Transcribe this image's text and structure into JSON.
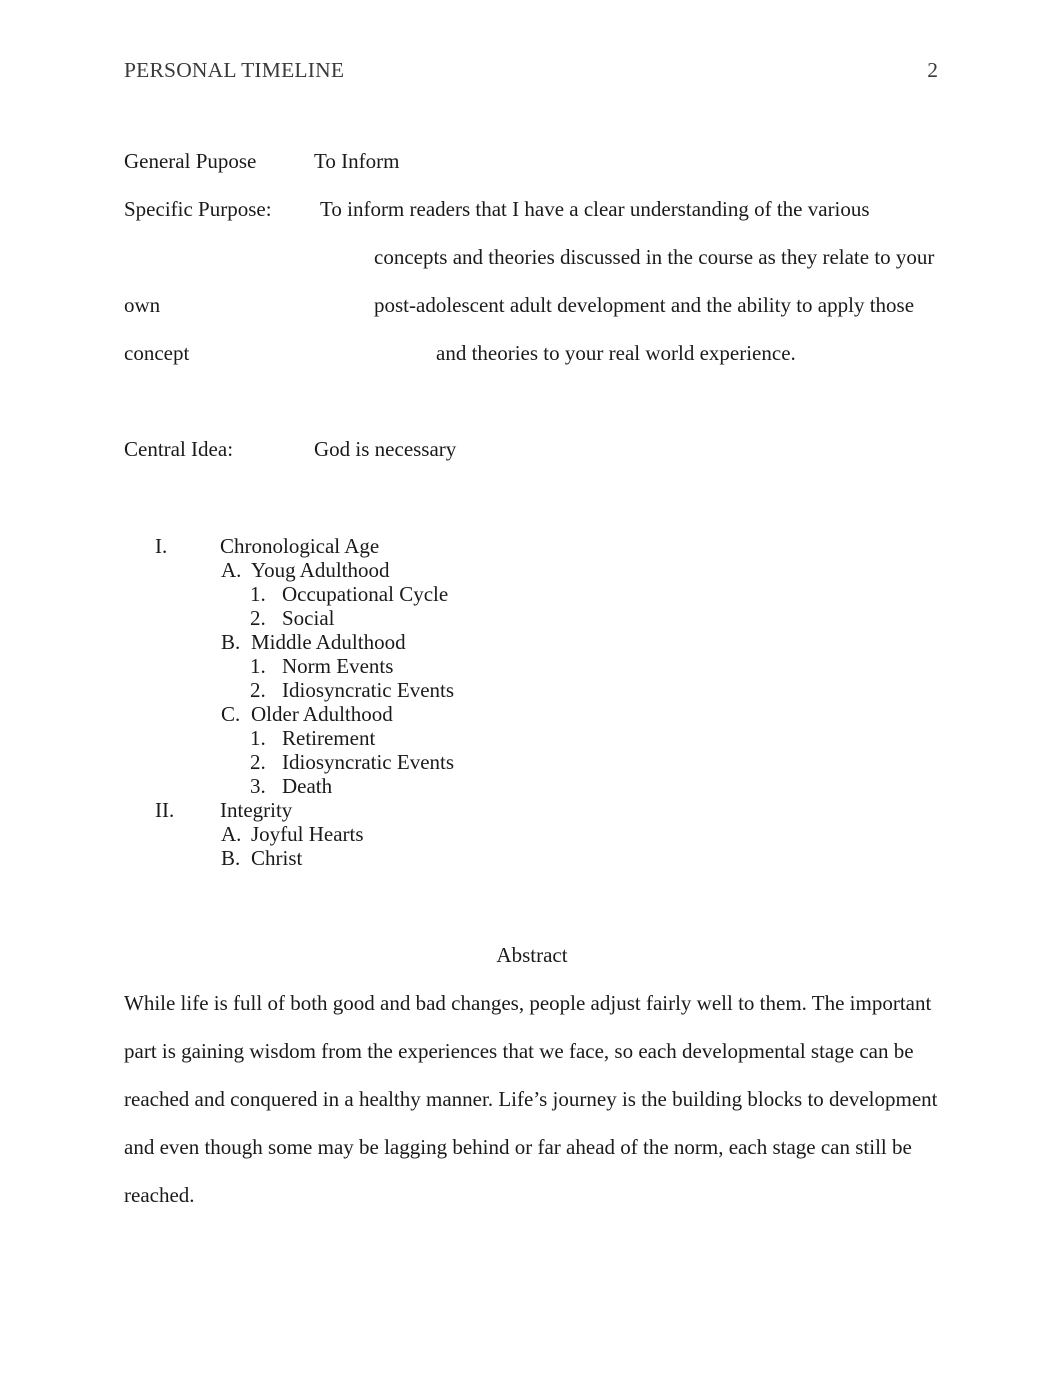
{
  "document": {
    "running_head": "PERSONAL TIMELINE",
    "page_number": "2"
  },
  "purpose": {
    "general_label": "General Pupose",
    "general_value": "To Inform",
    "specific_label": "Specific Purpose:",
    "specific_line1": "To inform readers that I have a clear understanding of the various",
    "specific_line2": "concepts and theories discussed in the course as they relate to your",
    "specific_line3_label": "own",
    "specific_line3": "post-adolescent adult development and the ability to apply those",
    "specific_line4_label": "concept",
    "specific_line4": "and theories to your real world experience.",
    "central_label": "Central Idea:",
    "central_value": "God is necessary"
  },
  "outline": [
    {
      "level": 1,
      "marker": "I.",
      "text": "Chronological Age"
    },
    {
      "level": 2,
      "marker": "A.",
      "text": "Youg Adulthood"
    },
    {
      "level": 3,
      "marker": "1.",
      "text": "Occupational Cycle"
    },
    {
      "level": 3,
      "marker": "2.",
      "text": "Social"
    },
    {
      "level": 2,
      "marker": "B.",
      "text": "Middle Adulthood"
    },
    {
      "level": 3,
      "marker": "1.",
      "text": "Norm Events"
    },
    {
      "level": 3,
      "marker": "2.",
      "text": "Idiosyncratic Events"
    },
    {
      "level": 2,
      "marker": "C.",
      "text": "Older Adulthood"
    },
    {
      "level": 3,
      "marker": "1.",
      "text": "Retirement"
    },
    {
      "level": 3,
      "marker": "2.",
      "text": "Idiosyncratic Events"
    },
    {
      "level": 3,
      "marker": "3.",
      "text": "Death"
    },
    {
      "level": 1,
      "marker": "II.",
      "text": "Integrity"
    },
    {
      "level": 2,
      "marker": "A.",
      "text": "Joyful Hearts"
    },
    {
      "level": 2,
      "marker": "B.",
      "text": "Christ"
    }
  ],
  "abstract": {
    "heading": "Abstract",
    "lines": [
      "While life is full of both good and bad changes, people adjust fairly well to them.  The important",
      "part is gaining wisdom from the experiences that we face, so each developmental stage can be",
      "reached and conquered in a healthy manner.  Life’s journey is the building blocks to development",
      "and even though some may be lagging behind or far ahead of the norm, each stage can still be",
      "reached."
    ]
  }
}
